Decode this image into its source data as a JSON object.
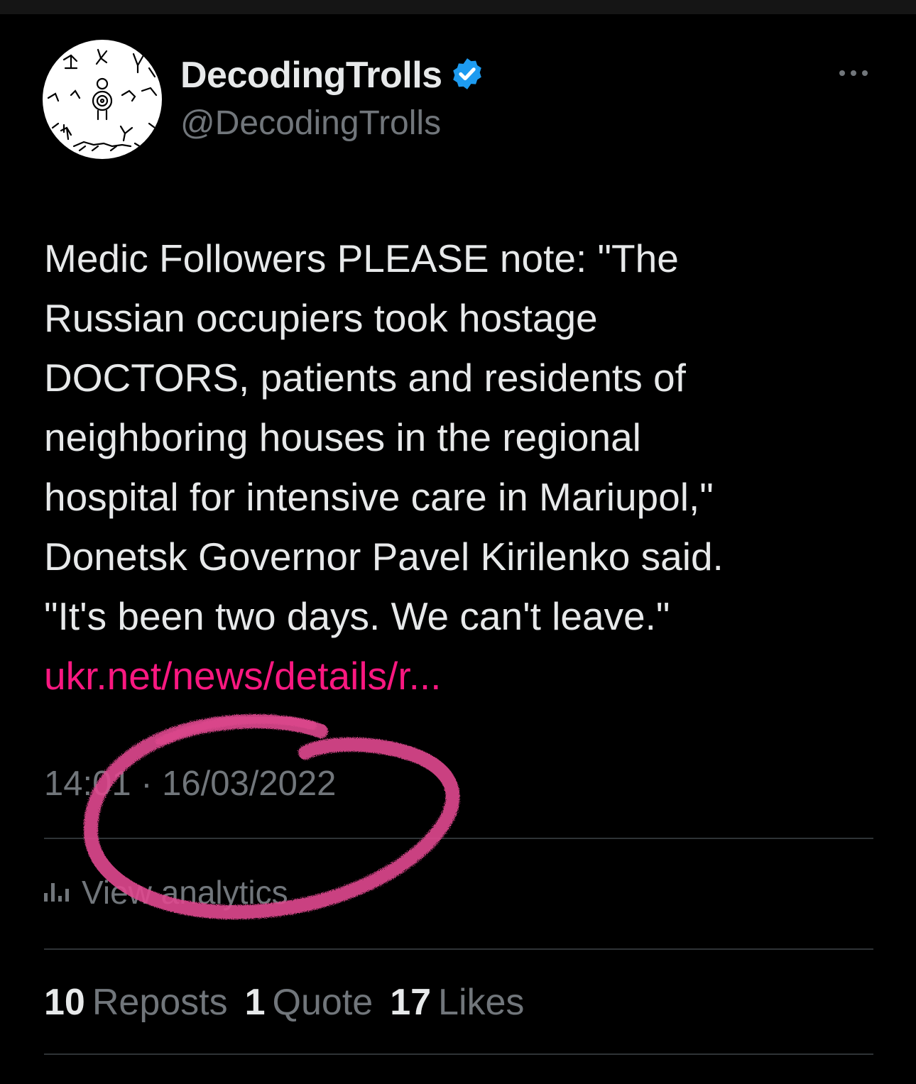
{
  "author": {
    "display_name": "DecodingTrolls",
    "handle": "@DecodingTrolls",
    "avatar_icon": "petroglyph-avatar",
    "verified_icon": "verified-badge-icon"
  },
  "tweet": {
    "lines": [
      "Medic Followers PLEASE note: \"The",
      "Russian occupiers took hostage",
      "DOCTORS, patients and residents of",
      "neighboring houses in the regional",
      "hospital for intensive care in Mariupol,\"",
      "Donetsk Governor Pavel Kirilenko said.",
      "\"It's been two days. We can't leave.\""
    ],
    "link": "ukr.net/news/details/r..."
  },
  "meta": {
    "timestamp": "14:01 · 16/03/2022"
  },
  "analytics": {
    "label": "View analytics",
    "icon": "bar-chart-icon"
  },
  "stats": {
    "reposts_count": "10",
    "reposts_label": "Reposts",
    "quotes_count": "1",
    "quotes_label": "Quote",
    "likes_count": "17",
    "likes_label": "Likes"
  },
  "colors": {
    "background": "#000000",
    "text_primary": "#e7e9ea",
    "text_secondary": "#71767b",
    "link": "#f91880",
    "verified": "#1d9bf0",
    "divider": "#2f3336",
    "annotation": "#e0488f"
  }
}
